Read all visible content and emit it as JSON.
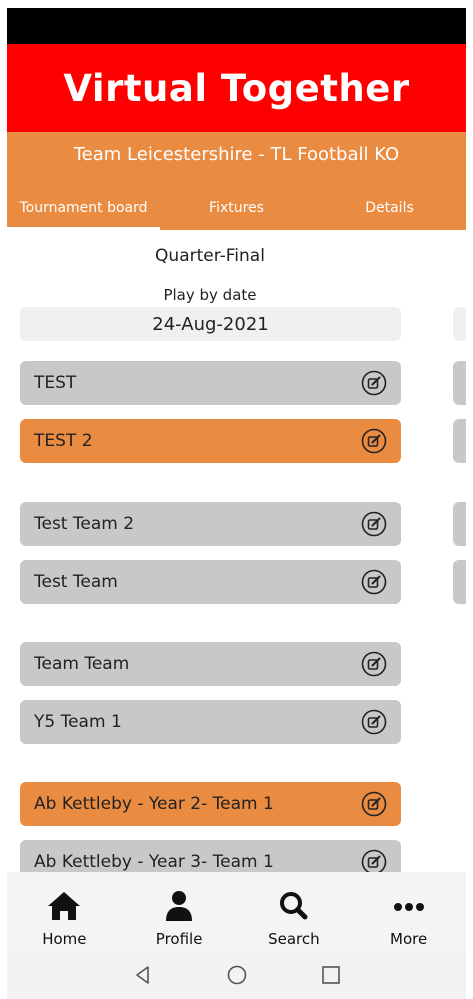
{
  "app": {
    "title": "Virtual Together"
  },
  "header": {
    "team_title": "Team Leicestershire - TL Football KO"
  },
  "tabs": [
    {
      "label": "Tournament board",
      "active": true
    },
    {
      "label": "Fixtures",
      "active": false
    },
    {
      "label": "Details",
      "active": false
    }
  ],
  "round": {
    "title": "Quarter-Final",
    "play_by_label": "Play by date",
    "play_by_date": "24-Aug-2021"
  },
  "matches": [
    {
      "teams": [
        {
          "name": "TEST",
          "winner": false
        },
        {
          "name": "TEST 2",
          "winner": true
        }
      ]
    },
    {
      "teams": [
        {
          "name": "Test Team 2",
          "winner": false
        },
        {
          "name": "Test Team",
          "winner": false
        }
      ]
    },
    {
      "teams": [
        {
          "name": "Team Team",
          "winner": false
        },
        {
          "name": "Y5 Team 1",
          "winner": false
        }
      ]
    },
    {
      "teams": [
        {
          "name": "Ab Kettleby - Year 2- Team 1",
          "winner": true
        },
        {
          "name": "Ab Kettleby - Year 3- Team 1",
          "winner": false
        }
      ]
    }
  ],
  "bottom_nav": [
    {
      "label": "Home",
      "icon": "home-icon"
    },
    {
      "label": "Profile",
      "icon": "profile-icon"
    },
    {
      "label": "Search",
      "icon": "search-icon"
    },
    {
      "label": "More",
      "icon": "more-icon"
    }
  ],
  "colors": {
    "brand_red": "#ff0000",
    "header_orange": "#ea8b42",
    "team_grey": "#c8c8c8",
    "winner_orange": "#ea8b42"
  }
}
